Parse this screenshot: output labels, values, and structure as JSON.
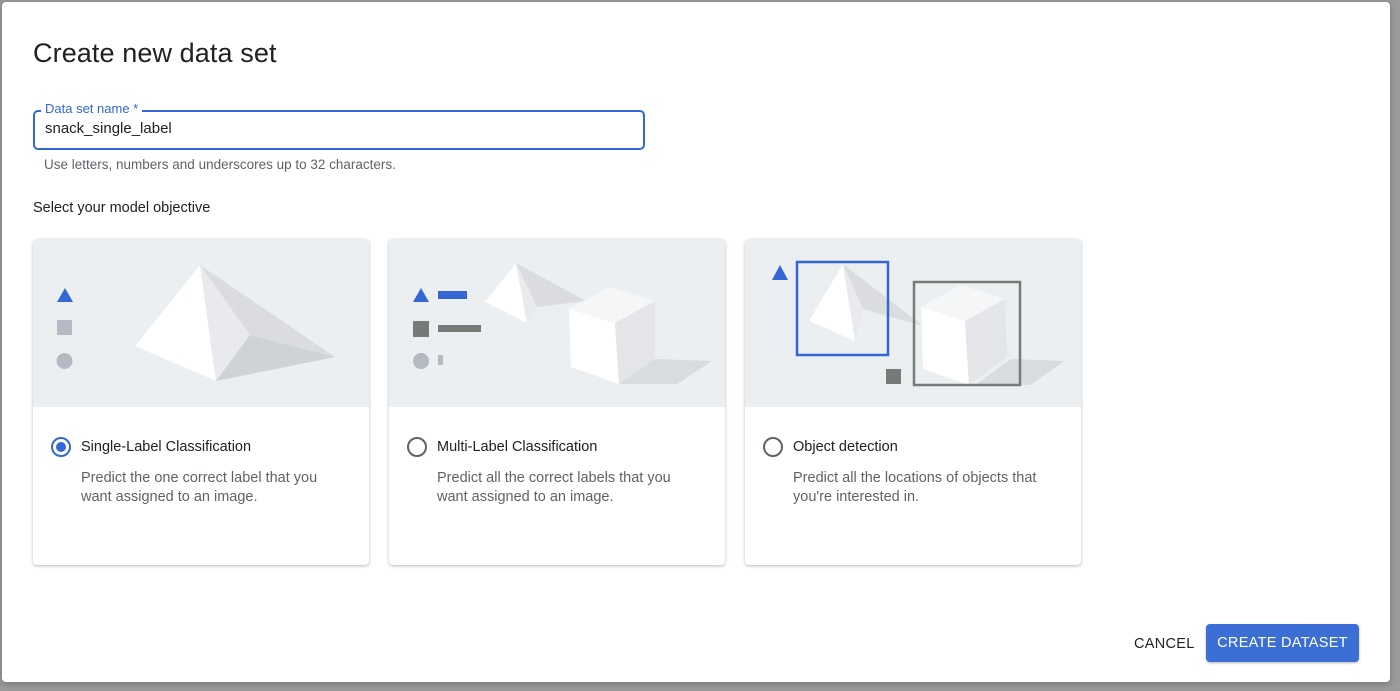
{
  "dialog": {
    "title": "Create new data set",
    "field": {
      "label": "Data set name *",
      "value": "snack_single_label",
      "helper": "Use letters, numbers and underscores up to 32 characters."
    },
    "section_label": "Select your model objective",
    "options": [
      {
        "title": "Single-Label Classification",
        "description": "Predict the one correct label that you want assigned to an image.",
        "selected": true,
        "illustration": "single-label-illustration"
      },
      {
        "title": "Multi-Label Classification",
        "description": "Predict all the correct labels that you want assigned to an image.",
        "selected": false,
        "illustration": "multi-label-illustration"
      },
      {
        "title": "Object detection",
        "description": "Predict all the locations of objects that you're interested in.",
        "selected": false,
        "illustration": "object-detection-illustration"
      }
    ],
    "actions": {
      "cancel": "CANCEL",
      "create": "CREATE DATASET"
    }
  },
  "colors": {
    "accent": "#3367d6",
    "illustration_bg": "#eceff1"
  }
}
